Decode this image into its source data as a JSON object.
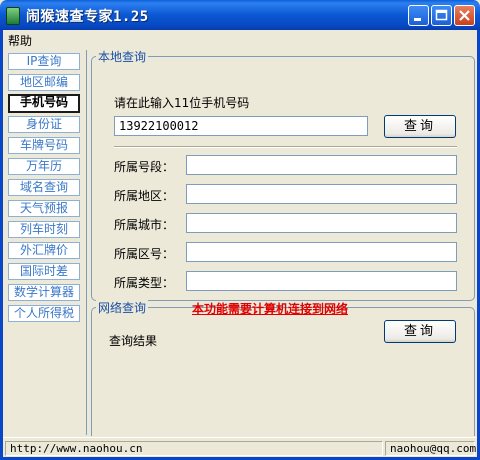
{
  "window": {
    "title": "闹猴速查专家1.25"
  },
  "menu": {
    "help": "帮助"
  },
  "nav": {
    "items": [
      {
        "label": "IP查询"
      },
      {
        "label": "地区邮编"
      },
      {
        "label": "手机号码",
        "active": true
      },
      {
        "label": "身份证"
      },
      {
        "label": "车牌号码"
      },
      {
        "label": "万年历"
      },
      {
        "label": "域名查询"
      },
      {
        "label": "天气预报"
      },
      {
        "label": "列车时刻"
      },
      {
        "label": "外汇牌价"
      },
      {
        "label": "国际时差"
      },
      {
        "label": "数学计算器"
      },
      {
        "label": "个人所得税"
      }
    ]
  },
  "local": {
    "title": "本地查询",
    "prompt": "请在此输入11位手机号码",
    "phone_value": "13922100012",
    "query_button": "查询",
    "fields": [
      {
        "label": "所属号段：",
        "value": ""
      },
      {
        "label": "所属地区：",
        "value": ""
      },
      {
        "label": "所属城市：",
        "value": ""
      },
      {
        "label": "所属区号：",
        "value": ""
      },
      {
        "label": "所属类型：",
        "value": ""
      }
    ]
  },
  "network": {
    "title": "网络查询",
    "warning": "本功能需要计算机连接到网络",
    "result_label": "查询结果",
    "query_button": "查询"
  },
  "status": {
    "url": "http://www.naohou.cn",
    "email": "naohou@qq.com"
  },
  "colors": {
    "title_bar": "#0a5fd8",
    "accent": "#3a78c8",
    "warning": "#e00000"
  }
}
